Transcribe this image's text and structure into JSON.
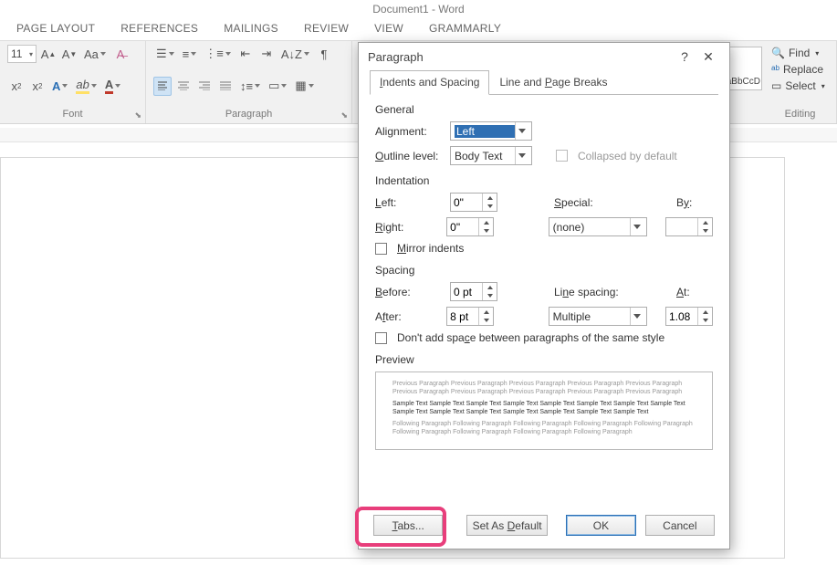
{
  "window": {
    "title": "Document1 - Word"
  },
  "ribbon_tabs": [
    "PAGE LAYOUT",
    "REFERENCES",
    "MAILINGS",
    "REVIEW",
    "VIEW",
    "GRAMMARLY"
  ],
  "ribbon": {
    "font_size": "11",
    "group_font": "Font",
    "group_paragraph": "Paragraph",
    "styles_label": "AaBbCcD",
    "editing": {
      "find": "Find",
      "replace": "Replace",
      "select": "Select",
      "label": "Editing"
    }
  },
  "dialog": {
    "title": "Paragraph",
    "tabs": {
      "indents": "Indents and Spacing",
      "breaks": "Line and Page Breaks"
    },
    "general": {
      "header": "General",
      "alignment_label": "Alignment:",
      "alignment_value": "Left",
      "outline_label": "Outline level:",
      "outline_value": "Body Text",
      "collapsed_label": "Collapsed by default"
    },
    "indent": {
      "header": "Indentation",
      "left_label": "Left:",
      "left_value": "0\"",
      "right_label": "Right:",
      "right_value": "0\"",
      "special_label": "Special:",
      "special_value": "(none)",
      "by_label": "By:",
      "by_value": "",
      "mirror_label": "Mirror indents"
    },
    "spacing": {
      "header": "Spacing",
      "before_label": "Before:",
      "before_value": "0 pt",
      "after_label": "After:",
      "after_value": "8 pt",
      "line_label": "Line spacing:",
      "line_value": "Multiple",
      "at_label": "At:",
      "at_value": "1.08",
      "dontadd_label": "Don't add space between paragraphs of the same style"
    },
    "preview": {
      "header": "Preview",
      "prev_line": "Previous Paragraph Previous Paragraph Previous Paragraph Previous Paragraph Previous Paragraph Previous Paragraph Previous Paragraph Previous Paragraph Previous Paragraph Previous Paragraph",
      "sample_line": "Sample Text Sample Text Sample Text Sample Text Sample Text Sample Text Sample Text Sample Text Sample Text Sample Text Sample Text Sample Text Sample Text Sample Text Sample Text",
      "follow_line": "Following Paragraph Following Paragraph Following Paragraph Following Paragraph Following Paragraph Following Paragraph Following Paragraph Following Paragraph Following Paragraph"
    },
    "buttons": {
      "tabs": "Tabs...",
      "setdefault": "Set As Default",
      "ok": "OK",
      "cancel": "Cancel"
    }
  }
}
